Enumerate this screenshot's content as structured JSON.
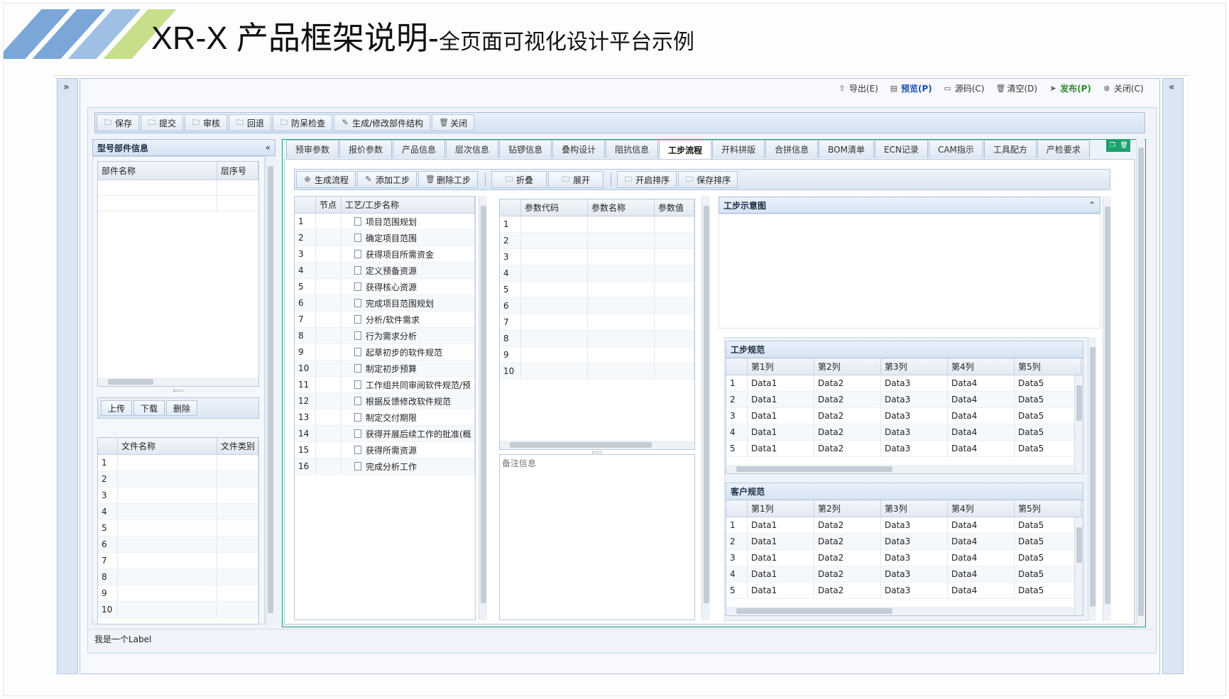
{
  "slide": {
    "title_main": "XR-X 产品框架说明-",
    "title_sub": "全页面可视化设计平台示例"
  },
  "sidebars": {
    "left_chevron": "»",
    "right_chevron": "«"
  },
  "top_actions": [
    {
      "label": "导出(E)",
      "icon": "export-icon",
      "style": "normal"
    },
    {
      "label": "预览(P)",
      "icon": "preview-icon",
      "style": "blue"
    },
    {
      "label": "源码(C)",
      "icon": "source-code-icon",
      "style": "normal"
    },
    {
      "label": "清空(D)",
      "icon": "trash-icon",
      "style": "normal"
    },
    {
      "label": "发布(P)",
      "icon": "send-icon",
      "style": "green"
    },
    {
      "label": "关闭(C)",
      "icon": "close-circle-icon",
      "style": "normal"
    }
  ],
  "main_toolbar": [
    {
      "label": "保存",
      "icon": "folder-icon"
    },
    {
      "label": "提交",
      "icon": "folder-icon"
    },
    {
      "label": "审核",
      "icon": "folder-icon"
    },
    {
      "label": "回退",
      "icon": "folder-icon"
    },
    {
      "label": "防呆检查",
      "icon": "folder-icon"
    },
    {
      "label": "生成/修改部件结构",
      "icon": "edit-icon"
    },
    {
      "label": "关闭",
      "icon": "trash-icon"
    }
  ],
  "left_panel": {
    "title": "型号部件信息",
    "collapse": "«",
    "parts_grid": {
      "columns": [
        "部件名称",
        "层序号"
      ]
    },
    "file_buttons": [
      "上传",
      "下载",
      "删除"
    ],
    "files_grid": {
      "columns": [
        "文件名称",
        "文件类别"
      ],
      "rows": [
        "1",
        "2",
        "3",
        "4",
        "5",
        "6",
        "7",
        "8",
        "9",
        "10"
      ]
    }
  },
  "tabs": [
    "预审参数",
    "报价参数",
    "产品信息",
    "层次信息",
    "钻锣信息",
    "叠构设计",
    "阻抗信息",
    "工步流程",
    "开料拼版",
    "合拼信息",
    "BOM清单",
    "ECN记录",
    "CAM指示",
    "工具配方",
    "产检要求"
  ],
  "active_tab": "工步流程",
  "process_toolbar": [
    {
      "label": "生成流程",
      "icon": "plus-circle-icon"
    },
    {
      "label": "添加工步",
      "icon": "edit-icon"
    },
    {
      "label": "删除工步",
      "icon": "trash-icon"
    },
    {
      "label": "折叠",
      "icon": "folder-icon"
    },
    {
      "label": "展开",
      "icon": "folder-icon"
    },
    {
      "label": "开启排序",
      "icon": "folder-icon"
    },
    {
      "label": "保存排序",
      "icon": "folder-icon"
    }
  ],
  "steps_grid": {
    "columns": [
      "节点",
      "工艺/工步名称"
    ],
    "rows": [
      {
        "n": "1",
        "name": "项目范围规划"
      },
      {
        "n": "2",
        "name": "确定项目范围"
      },
      {
        "n": "3",
        "name": "获得项目所需资金"
      },
      {
        "n": "4",
        "name": "定义预备资源"
      },
      {
        "n": "5",
        "name": "获得核心资源"
      },
      {
        "n": "6",
        "name": "完成项目范围规划"
      },
      {
        "n": "7",
        "name": "分析/软件需求"
      },
      {
        "n": "8",
        "name": "行为需求分析"
      },
      {
        "n": "9",
        "name": "起草初步的软件规范"
      },
      {
        "n": "10",
        "name": "制定初步预算"
      },
      {
        "n": "11",
        "name": "工作组共同审阅软件规范/预"
      },
      {
        "n": "12",
        "name": "根据反馈修改软件规范"
      },
      {
        "n": "13",
        "name": "制定交付期限"
      },
      {
        "n": "14",
        "name": "获得开展后续工作的批准(概"
      },
      {
        "n": "15",
        "name": "获得所需资源"
      },
      {
        "n": "16",
        "name": "完成分析工作"
      }
    ]
  },
  "params_grid": {
    "columns": [
      "参数代码",
      "参数名称",
      "参数值"
    ],
    "rows": [
      "1",
      "2",
      "3",
      "4",
      "5",
      "6",
      "7",
      "8",
      "9",
      "10"
    ]
  },
  "remarks": {
    "placeholder": "备注信息"
  },
  "diagram_panel": {
    "title": "工步示意图",
    "collapse": "⌃"
  },
  "spec_grids": [
    {
      "title": "工步规范",
      "columns": [
        "第1列",
        "第2列",
        "第3列",
        "第4列",
        "第5列"
      ],
      "rows": [
        [
          "1",
          "Data1",
          "Data2",
          "Data3",
          "Data4",
          "Data5"
        ],
        [
          "2",
          "Data1",
          "Data2",
          "Data3",
          "Data4",
          "Data5"
        ],
        [
          "3",
          "Data1",
          "Data2",
          "Data3",
          "Data4",
          "Data5"
        ],
        [
          "4",
          "Data1",
          "Data2",
          "Data3",
          "Data4",
          "Data5"
        ],
        [
          "5",
          "Data1",
          "Data2",
          "Data3",
          "Data4",
          "Data5"
        ]
      ]
    },
    {
      "title": "客户规范",
      "columns": [
        "第1列",
        "第2列",
        "第3列",
        "第4列",
        "第5列"
      ],
      "rows": [
        [
          "1",
          "Data1",
          "Data2",
          "Data3",
          "Data4",
          "Data5"
        ],
        [
          "2",
          "Data1",
          "Data2",
          "Data3",
          "Data4",
          "Data5"
        ],
        [
          "3",
          "Data1",
          "Data2",
          "Data3",
          "Data4",
          "Data5"
        ],
        [
          "4",
          "Data1",
          "Data2",
          "Data3",
          "Data4",
          "Data5"
        ],
        [
          "5",
          "Data1",
          "Data2",
          "Data3",
          "Data4",
          "Data5"
        ]
      ]
    }
  ],
  "footer_label": "我是一个Label",
  "colors": {
    "stripe_blue": "#7aa7d8",
    "stripe_green": "#c7df8a",
    "accent_green": "#1aa36e",
    "publish_green": "#2d8a2d",
    "preview_blue": "#1a4fb4"
  }
}
